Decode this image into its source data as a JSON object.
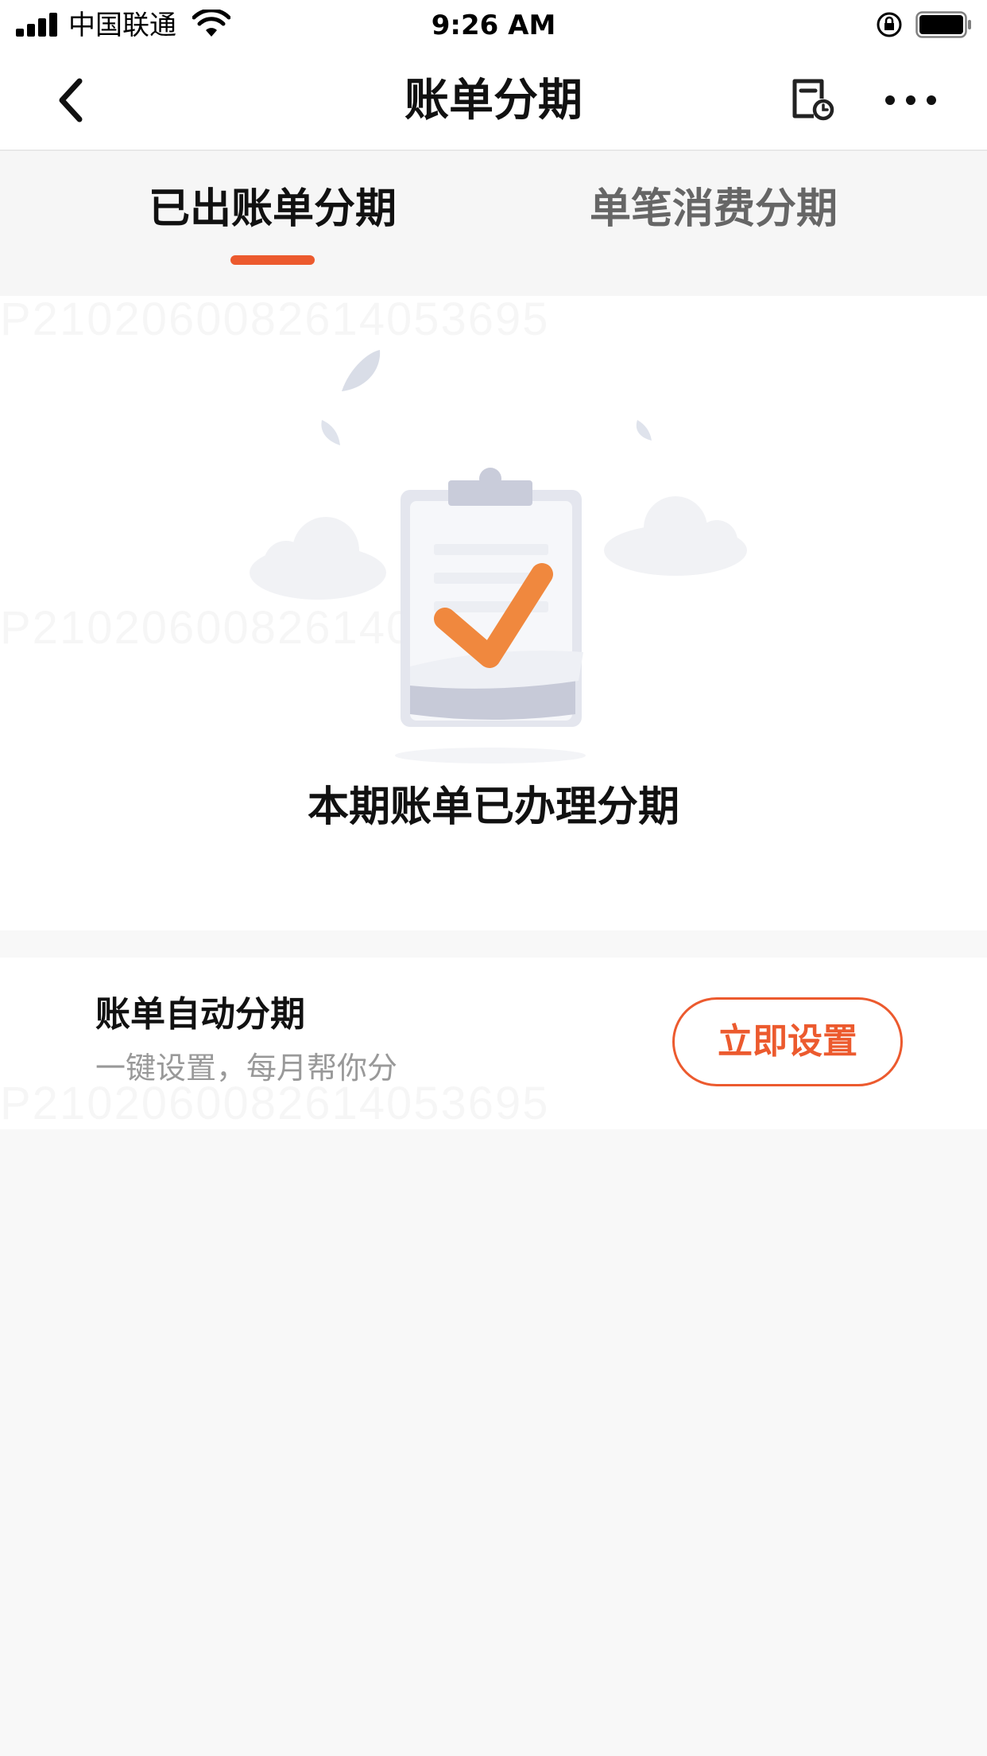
{
  "status_bar": {
    "carrier": "中国联通",
    "time": "9:26 AM",
    "icons": [
      "signal-icon",
      "wifi-icon",
      "rotation-lock-icon",
      "battery-icon"
    ]
  },
  "nav": {
    "title": "账单分期",
    "back_icon": "chevron-left-icon",
    "bill_icon": "bill-clock-icon",
    "more_icon": "more-dots-icon"
  },
  "tabs": [
    {
      "label": "已出账单分期",
      "active": true
    },
    {
      "label": "单笔消费分期",
      "active": false
    }
  ],
  "empty_state": {
    "illustration": "clipboard-check-illustration",
    "message": "本期账单已办理分期"
  },
  "auto_installment": {
    "title": "账单自动分期",
    "subtitle": "一键设置，每月帮你分",
    "button_label": "立即设置"
  },
  "watermark": "P2102060082614053695",
  "colors": {
    "accent": "#ec5a2e",
    "check": "#f0883e",
    "page_bg": "#f8f8f8"
  }
}
